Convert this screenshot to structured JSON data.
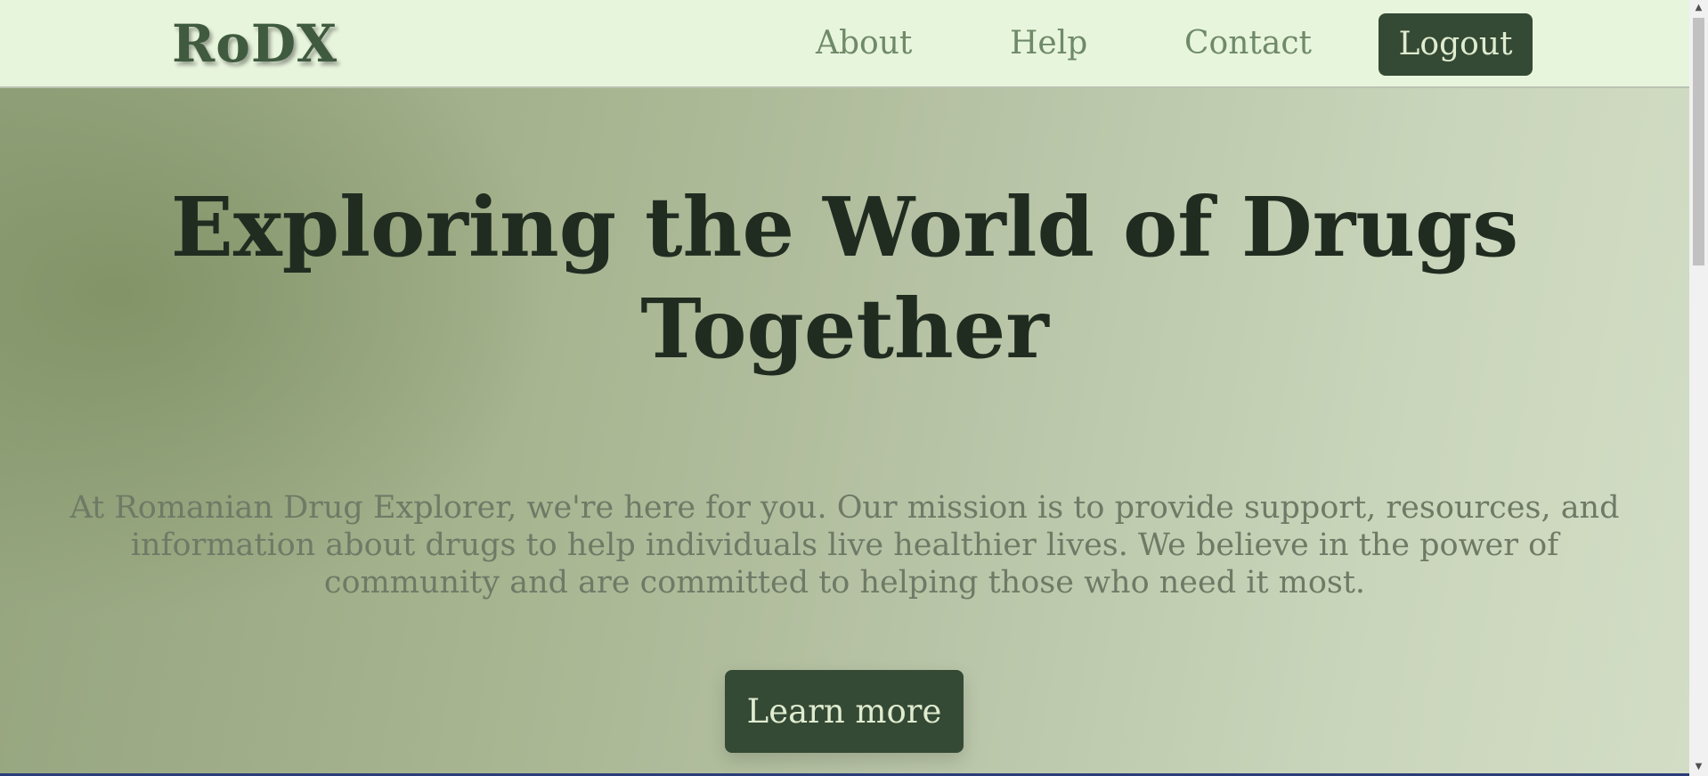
{
  "navbar": {
    "logo": "RoDX",
    "links": [
      "About",
      "Help",
      "Contact"
    ],
    "logout_label": "Logout"
  },
  "hero": {
    "title_line1": "Exploring the World of Drugs",
    "title_line2": "Together",
    "description": "At Romanian Drug Explorer, we're here for you. Our mission is to provide support, resources, and information about drugs to help individuals live healthier lives. We believe in the power of community and are committed to helping those who need it most.",
    "cta_label": "Learn more"
  },
  "scrollbar": {
    "up_arrow": "▲",
    "down_arrow": "▼"
  },
  "colors": {
    "nav_background": "#e8f5dd",
    "button_background": "#354a35",
    "title_color": "#212c21"
  }
}
